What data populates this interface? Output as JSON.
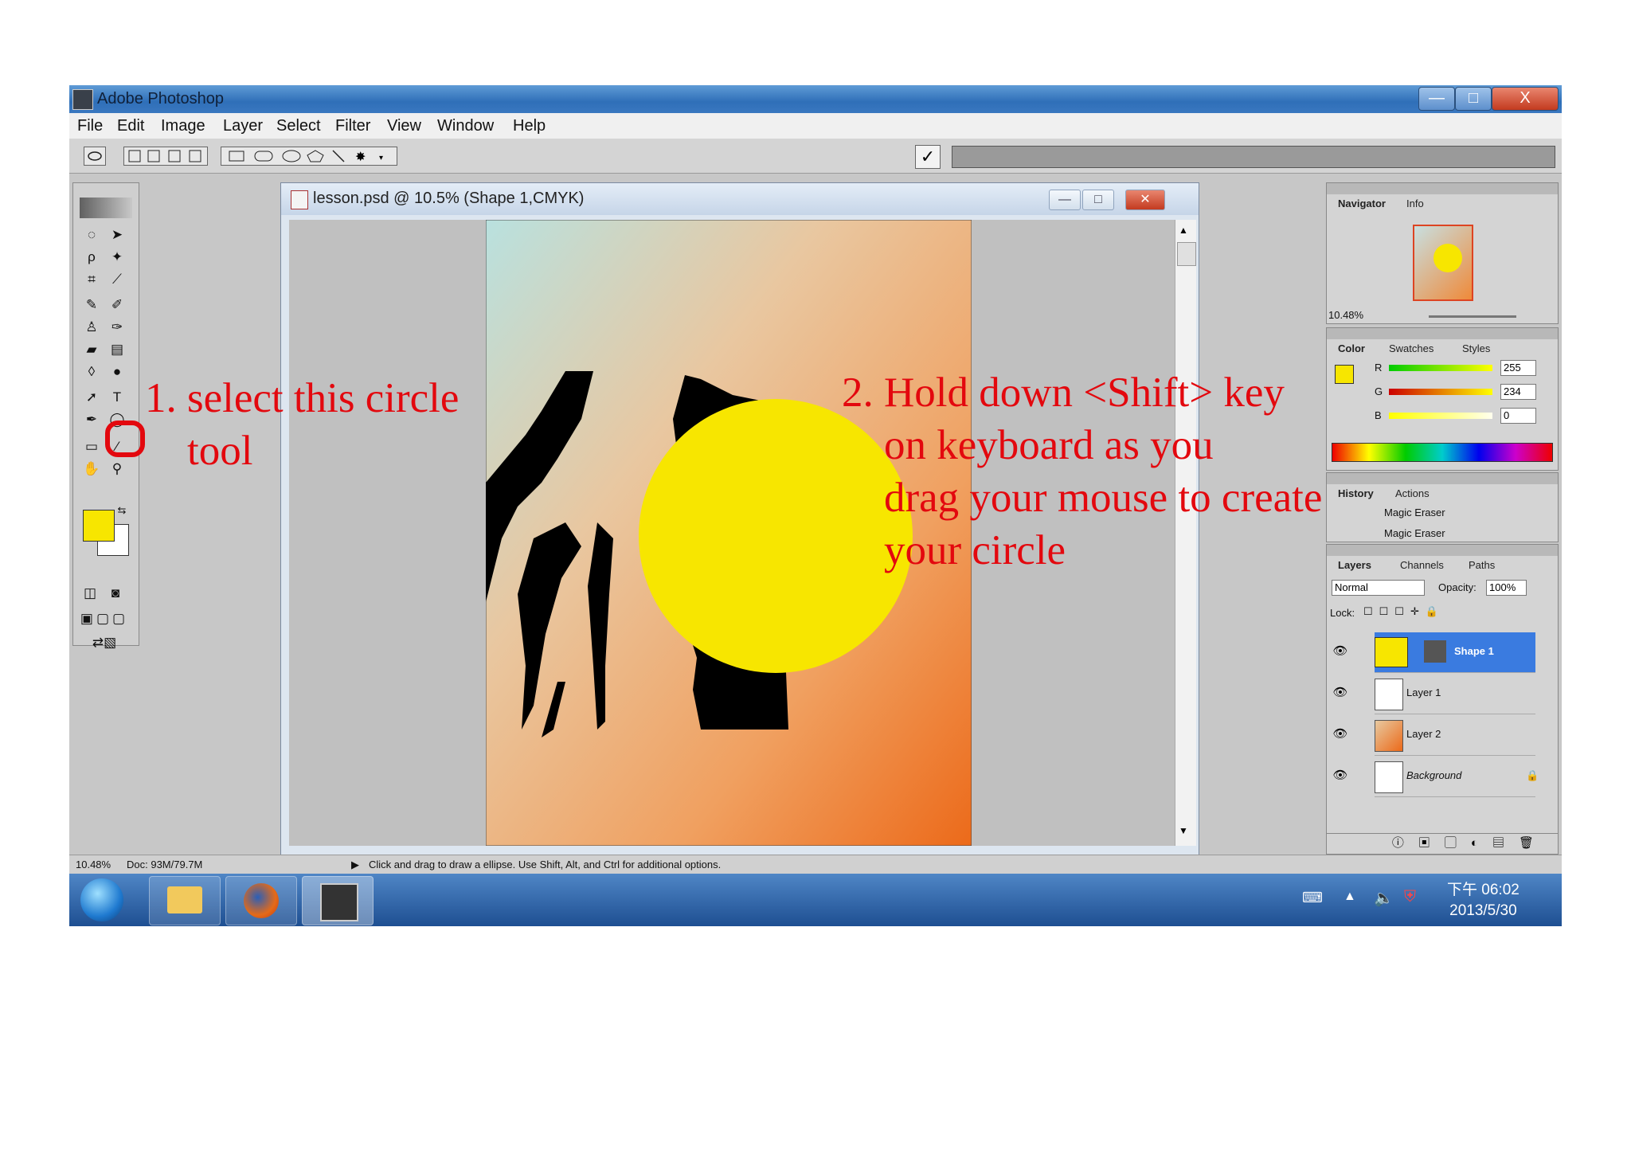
{
  "window": {
    "title": "Adobe Photoshop",
    "min": "—",
    "max": "□",
    "close": "X"
  },
  "menu": [
    "File",
    "Edit",
    "Image",
    "Layer",
    "Select",
    "Filter",
    "View",
    "Window",
    "Help"
  ],
  "options_bar": {
    "commit": "✓"
  },
  "document": {
    "title": "lesson.psd @ 10.5% (Shape 1,CMYK)",
    "min": "—",
    "max": "□",
    "close": "✕"
  },
  "colors": {
    "foreground": "#f7e600",
    "background": "#ffffff",
    "annotation": "#e3080e"
  },
  "navigator": {
    "tabs": [
      "Navigator",
      "Info"
    ],
    "zoom": "10.48%"
  },
  "color_panel": {
    "tabs": [
      "Color",
      "Swatches",
      "Styles"
    ],
    "r_label": "R",
    "g_label": "G",
    "b_label": "B",
    "r": "255",
    "g": "234",
    "b": "0"
  },
  "history": {
    "tabs": [
      "History",
      "Actions"
    ],
    "items": [
      "Magic Eraser",
      "Magic Eraser"
    ]
  },
  "layers": {
    "tabs": [
      "Layers",
      "Channels",
      "Paths"
    ],
    "blend_mode": "Normal",
    "opacity_label": "Opacity:",
    "opacity": "100%",
    "lock_label": "Lock:",
    "items": [
      "Shape 1",
      "Layer 1",
      "Layer 2",
      "Background"
    ]
  },
  "status": {
    "zoom": "10.48%",
    "doc": "Doc: 93M/79.7M",
    "hint": "Click and drag to draw a ellipse.  Use Shift, Alt, and Ctrl for additional options."
  },
  "taskbar": {
    "time": "下午 06:02",
    "date": "2013/5/30"
  },
  "annotations": {
    "step1": "1. select this circle\n    tool",
    "step2": "2. Hold down <Shift> key\n    on keyboard as you\n    drag your mouse to create\n    your circle"
  }
}
